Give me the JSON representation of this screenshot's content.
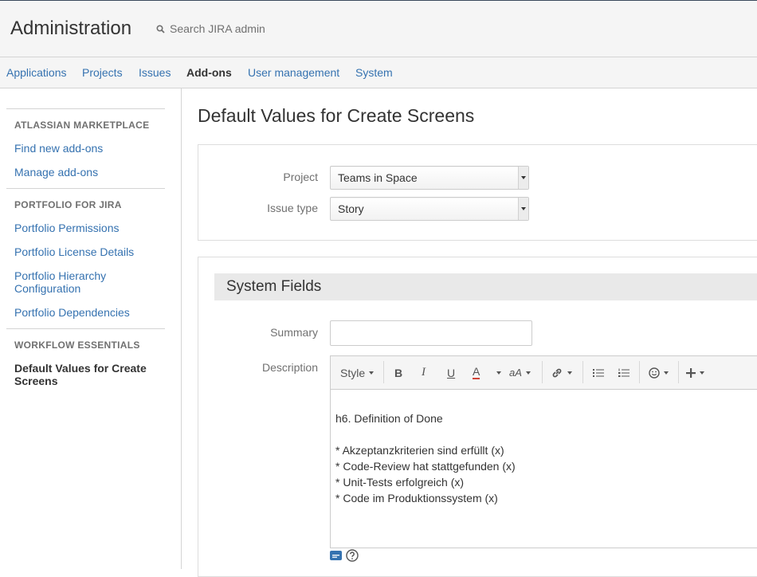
{
  "header": {
    "title": "Administration",
    "search_placeholder": "Search JIRA admin"
  },
  "nav": {
    "items": [
      "Applications",
      "Projects",
      "Issues",
      "Add-ons",
      "User management",
      "System"
    ],
    "active": "Add-ons"
  },
  "sidebar": {
    "sections": [
      {
        "heading": "ATLASSIAN MARKETPLACE",
        "links": [
          "Find new add-ons",
          "Manage add-ons"
        ]
      },
      {
        "heading": "PORTFOLIO FOR JIRA",
        "links": [
          "Portfolio Permissions",
          "Portfolio License Details",
          "Portfolio Hierarchy Configuration",
          "Portfolio Dependencies"
        ]
      },
      {
        "heading": "WORKFLOW ESSENTIALS",
        "links": [
          "Default Values for Create Screens"
        ]
      }
    ]
  },
  "main": {
    "title": "Default Values for Create Screens",
    "project_label": "Project",
    "project_value": "Teams in Space",
    "issue_type_label": "Issue type",
    "issue_type_value": "Story",
    "section_title": "System Fields",
    "summary_label": "Summary",
    "summary_value": "",
    "description_label": "Description",
    "toolbar": {
      "style_label": "Style",
      "bold": "B",
      "italic": "I",
      "underline": "U",
      "text_color": "A",
      "size": "aA"
    },
    "description_lines": [
      "h6. Definition of Done",
      "",
      "* Akzeptanzkriterien sind erfüllt (x)",
      "* Code-Review hat stattgefunden (x)",
      "* Unit-Tests erfolgreich (x)",
      "* Code im Produktionssystem (x)"
    ]
  },
  "icons": {
    "search": "search-icon",
    "link": "link-icon",
    "bullet_list": "bullet-list-icon",
    "numbered_list": "numbered-list-icon",
    "emoticon": "emoticon-icon",
    "insert": "plus-icon",
    "wiki_markup": "wiki-markup-icon",
    "help": "help-icon"
  },
  "colors": {
    "link": "#3572b0",
    "text_color_underline": "#d04437"
  }
}
